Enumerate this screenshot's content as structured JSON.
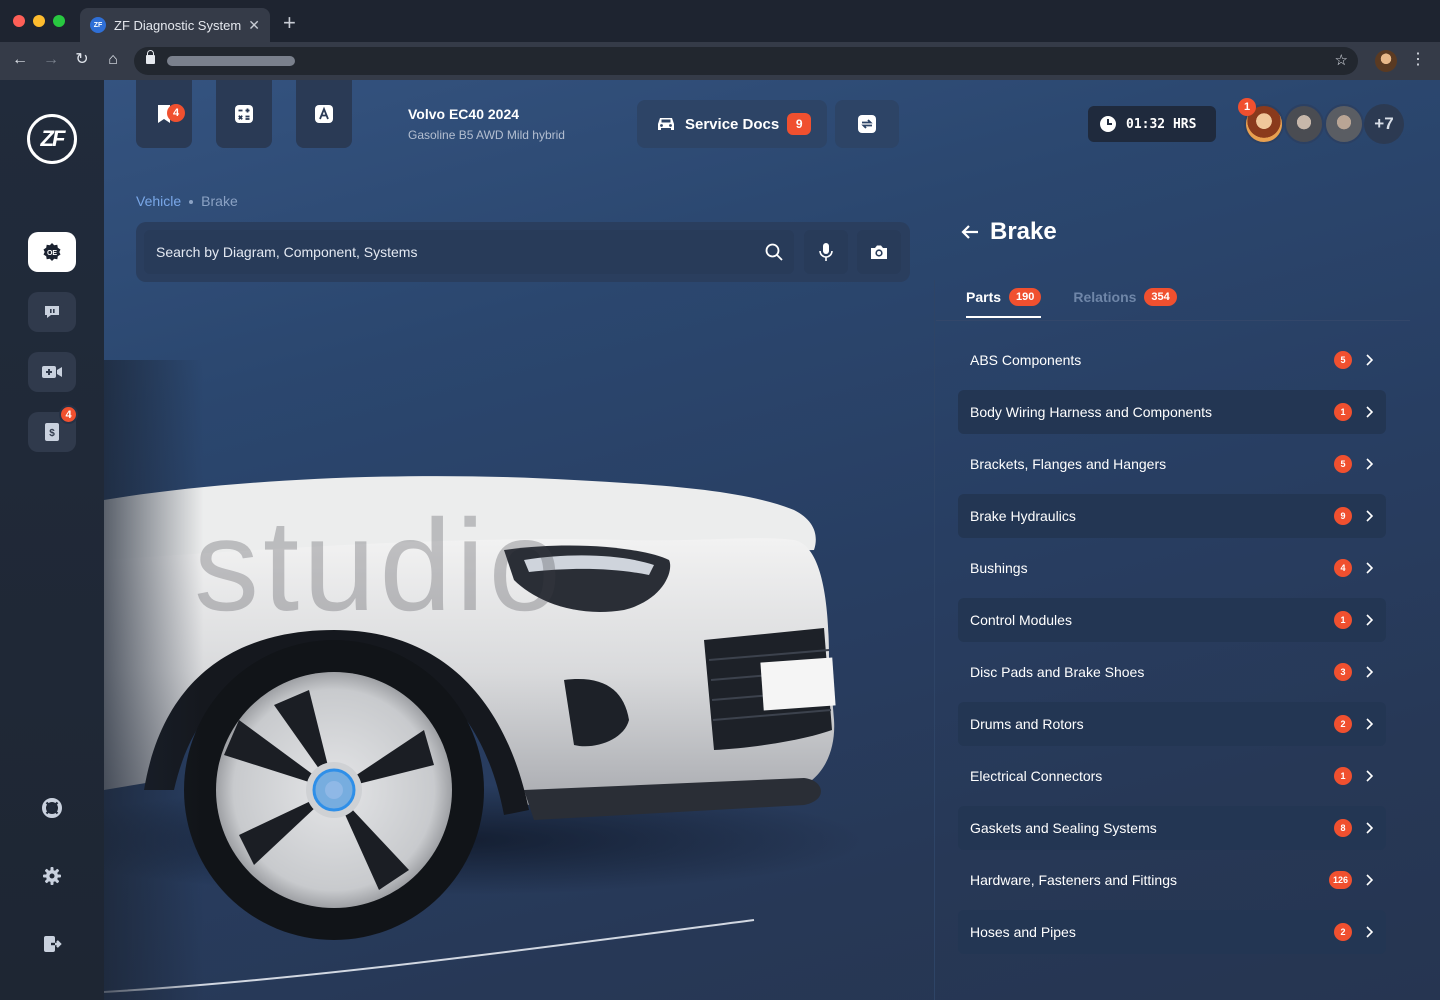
{
  "browser": {
    "tab_title": "ZF Diagnostic System",
    "favicon_text": "ZF"
  },
  "app": {
    "logo_text": "ZF",
    "sidebar": {
      "items": [
        {
          "name": "oe-icon",
          "badge": null
        },
        {
          "name": "chat-icon",
          "badge": null
        },
        {
          "name": "video-call-icon",
          "badge": null
        },
        {
          "name": "billing-icon",
          "badge": "4"
        }
      ],
      "bottom": [
        "support-icon",
        "settings-icon",
        "logout-icon"
      ]
    },
    "topbar": {
      "bookmark_badge": "4",
      "vehicle_name": "Volvo EC40 2024",
      "vehicle_sub": "Gasoline B5 AWD Mild hybrid",
      "service_docs_label": "Service Docs",
      "service_docs_count": "9",
      "timer": "01:32 HRS",
      "participants_badge": "1",
      "participants_more": "+7"
    },
    "breadcrumb": {
      "root": "Vehicle",
      "current": "Brake"
    },
    "search": {
      "placeholder": "Search by Diagram, Component, Systems"
    },
    "car_watermark": "studio",
    "panel": {
      "title": "Brake",
      "tabs": [
        {
          "label": "Parts",
          "count": "190"
        },
        {
          "label": "Relations",
          "count": "354"
        }
      ],
      "items": [
        {
          "label": "ABS Components",
          "count": "5"
        },
        {
          "label": "Body Wiring Harness and Components",
          "count": "1"
        },
        {
          "label": "Brackets, Flanges and Hangers",
          "count": "5"
        },
        {
          "label": "Brake Hydraulics",
          "count": "9"
        },
        {
          "label": "Bushings",
          "count": "4"
        },
        {
          "label": "Control Modules",
          "count": "1"
        },
        {
          "label": "Disc Pads and Brake Shoes",
          "count": "3"
        },
        {
          "label": "Drums and Rotors",
          "count": "2"
        },
        {
          "label": "Electrical Connectors",
          "count": "1"
        },
        {
          "label": "Gaskets and Sealing Systems",
          "count": "8"
        },
        {
          "label": "Hardware, Fasteners and Fittings",
          "count": "126"
        },
        {
          "label": "Hoses and Pipes",
          "count": "2"
        }
      ]
    }
  },
  "colors": {
    "accent_red": "#f0502f",
    "link_blue": "#79a7e8",
    "hotspot_blue": "#2f8fe8"
  }
}
